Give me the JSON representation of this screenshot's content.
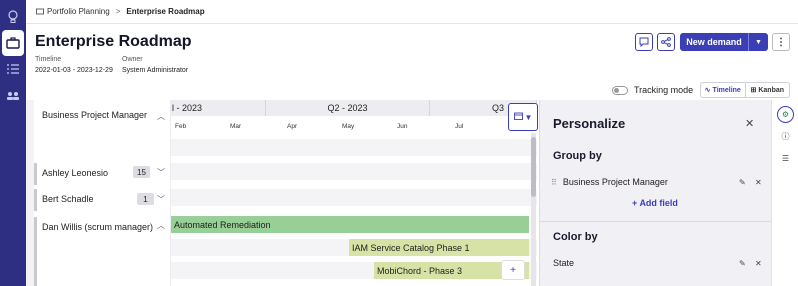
{
  "breadcrumb": {
    "parent": "Portfolio Planning",
    "current": "Enterprise Roadmap"
  },
  "header": {
    "title": "Enterprise Roadmap",
    "timeline_label": "Timeline",
    "timeline_value": "2022-01-03 - 2023-12-29",
    "owner_label": "Owner",
    "owner_value": "System Administrator",
    "new_demand": "New demand"
  },
  "controls": {
    "tracking_mode": "Tracking mode",
    "view_timeline": "Timeline",
    "view_kanban": "Kanban"
  },
  "roadmap": {
    "group_header": "Business Project Manager",
    "quarters": [
      {
        "label": "l - 2023"
      },
      {
        "label": "Q2 - 2023"
      },
      {
        "label": "Q3"
      }
    ],
    "months": [
      "Feb",
      "Mar",
      "Apr",
      "May",
      "Jun",
      "Jul"
    ],
    "groups": [
      {
        "name": "Ashley Leonesio",
        "count": "15"
      },
      {
        "name": "Bert Schadle",
        "count": "1"
      },
      {
        "name": "Dan Willis (scrum manager)"
      }
    ],
    "bars": [
      {
        "label": "Automated Remediation",
        "color": "#98cf97"
      },
      {
        "label": "IAM Service Catalog Phase 1",
        "color": "#d7e3a6"
      },
      {
        "label": "MobiChord - Phase 3",
        "color": "#d7e3a6"
      }
    ]
  },
  "personalize": {
    "title": "Personalize",
    "group_by_label": "Group by",
    "group_by_field": "Business Project Manager",
    "add_field": "Add field",
    "color_by_label": "Color by",
    "color_by_field": "State"
  },
  "colors": {
    "accent": "#3b3fb6",
    "rail": "#2e2f82"
  }
}
